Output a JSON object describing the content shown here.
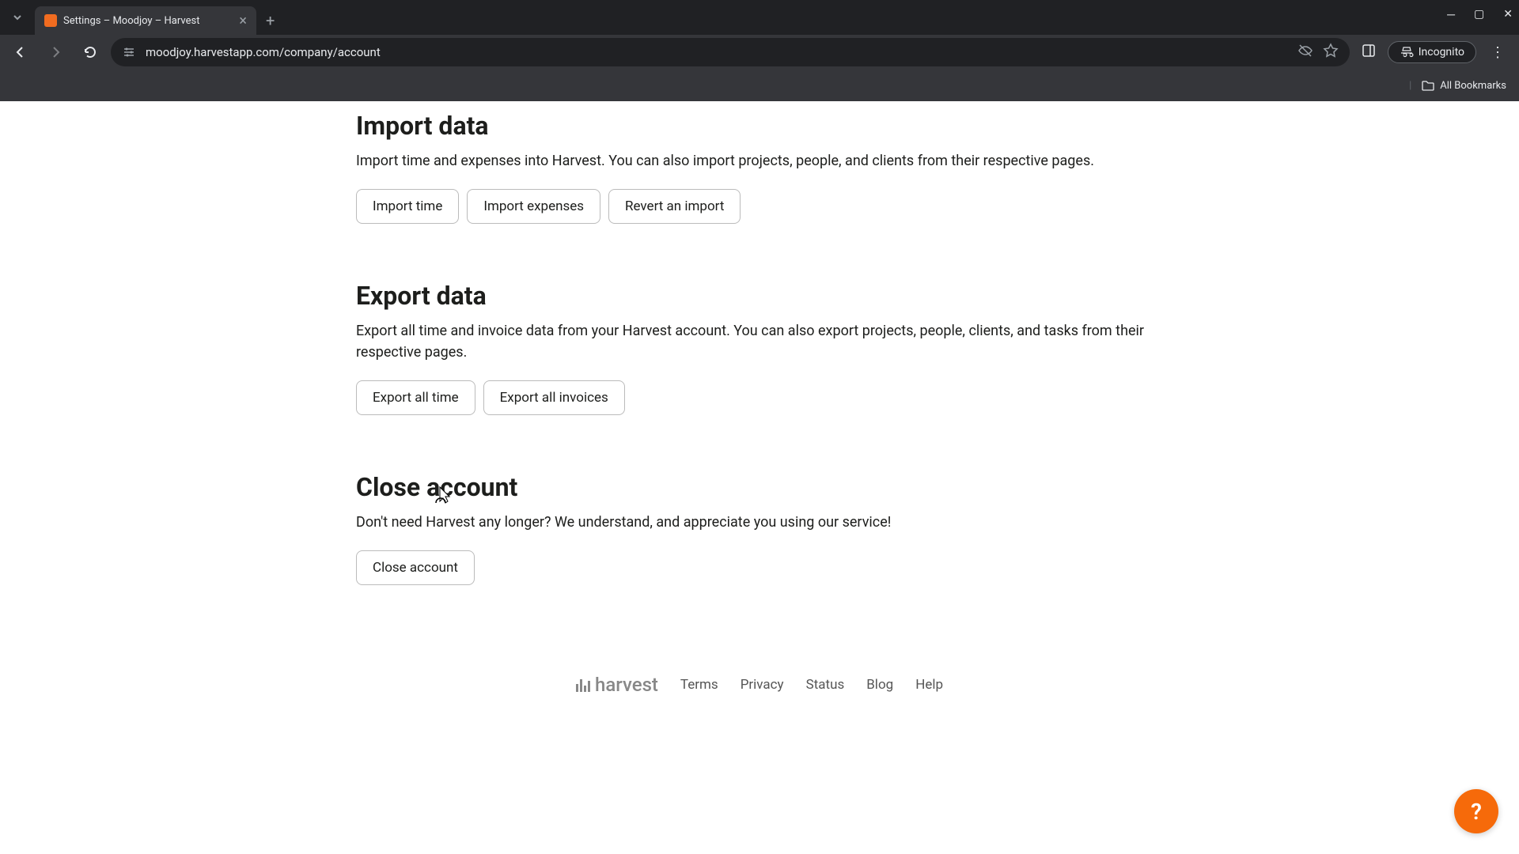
{
  "browser": {
    "tab_title": "Settings – Moodjoy – Harvest",
    "url": "moodjoy.harvestapp.com/company/account",
    "incognito_label": "Incognito",
    "all_bookmarks": "All Bookmarks"
  },
  "sections": {
    "import": {
      "title": "Import data",
      "description": "Import time and expenses into Harvest. You can also import projects, people, and clients from their respective pages.",
      "buttons": {
        "import_time": "Import time",
        "import_expenses": "Import expenses",
        "revert_import": "Revert an import"
      }
    },
    "export": {
      "title": "Export data",
      "description": "Export all time and invoice data from your Harvest account. You can also export projects, people, clients, and tasks from their respective pages.",
      "buttons": {
        "export_time": "Export all time",
        "export_invoices": "Export all invoices"
      }
    },
    "close": {
      "title": "Close account",
      "description": "Don't need Harvest any longer? We understand, and appreciate you using our service!",
      "buttons": {
        "close_account": "Close account"
      }
    }
  },
  "footer": {
    "logo_text": "harvest",
    "links": {
      "terms": "Terms",
      "privacy": "Privacy",
      "status": "Status",
      "blog": "Blog",
      "help": "Help"
    }
  },
  "help_fab": "?"
}
